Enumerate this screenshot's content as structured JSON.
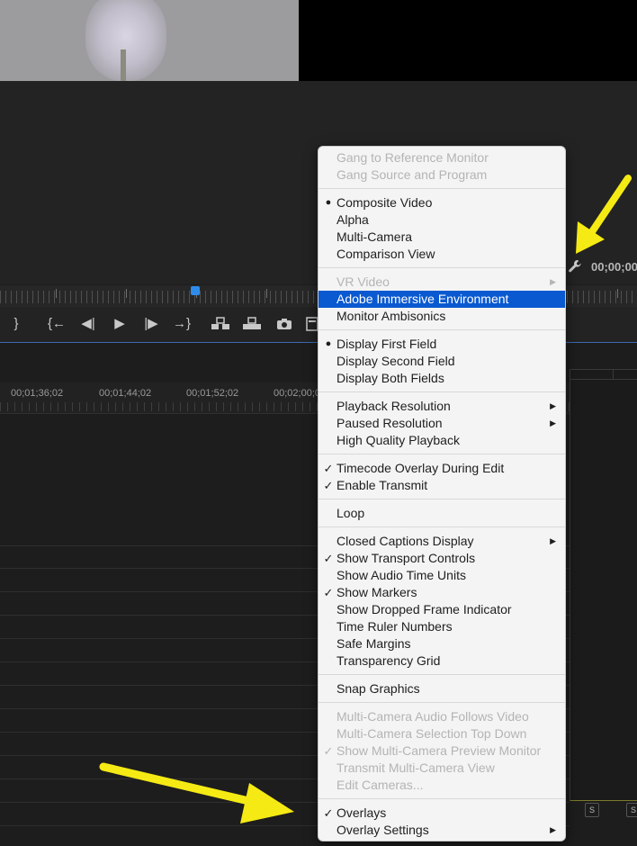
{
  "timeline": {
    "timecode": "00;00;00",
    "ruler_labels": [
      "00;01;36;02",
      "00;01;44;02",
      "00;01;52;02",
      "00;02;00;0"
    ]
  },
  "transport_icons": [
    "mark-out-icon",
    "go-to-in-icon",
    "step-back-icon",
    "play-icon",
    "step-forward-icon",
    "go-to-out-icon",
    "insert-icon",
    "overwrite-icon",
    "export-frame-icon",
    "button-editor-icon"
  ],
  "track_buttons": [
    "S",
    "S"
  ],
  "menu": {
    "sections": [
      {
        "items": [
          {
            "label": "Gang to Reference Monitor",
            "disabled": true
          },
          {
            "label": "Gang Source and Program",
            "disabled": true
          }
        ]
      },
      {
        "items": [
          {
            "label": "Composite Video",
            "mark": "dot"
          },
          {
            "label": "Alpha"
          },
          {
            "label": "Multi-Camera"
          },
          {
            "label": "Comparison View"
          }
        ]
      },
      {
        "items": [
          {
            "label": "VR Video",
            "disabled": true,
            "submenu": true
          },
          {
            "label": "Adobe Immersive Environment",
            "highlighted": true
          },
          {
            "label": "Monitor Ambisonics"
          }
        ]
      },
      {
        "items": [
          {
            "label": "Display First Field",
            "mark": "dot"
          },
          {
            "label": "Display Second Field"
          },
          {
            "label": "Display Both Fields"
          }
        ]
      },
      {
        "items": [
          {
            "label": "Playback Resolution",
            "submenu": true
          },
          {
            "label": "Paused Resolution",
            "submenu": true
          },
          {
            "label": "High Quality Playback"
          }
        ]
      },
      {
        "items": [
          {
            "label": "Timecode Overlay During Edit",
            "mark": "check"
          },
          {
            "label": "Enable Transmit",
            "mark": "check"
          }
        ]
      },
      {
        "items": [
          {
            "label": "Loop"
          }
        ]
      },
      {
        "items": [
          {
            "label": "Closed Captions Display",
            "submenu": true
          },
          {
            "label": "Show Transport Controls",
            "mark": "check"
          },
          {
            "label": "Show Audio Time Units"
          },
          {
            "label": "Show Markers",
            "mark": "check"
          },
          {
            "label": "Show Dropped Frame Indicator"
          },
          {
            "label": "Time Ruler Numbers"
          },
          {
            "label": "Safe Margins"
          },
          {
            "label": "Transparency Grid"
          }
        ]
      },
      {
        "items": [
          {
            "label": "Snap Graphics"
          }
        ]
      },
      {
        "items": [
          {
            "label": "Multi-Camera Audio Follows Video",
            "disabled": true
          },
          {
            "label": "Multi-Camera Selection Top Down",
            "disabled": true
          },
          {
            "label": "Show Multi-Camera Preview Monitor",
            "disabled": true,
            "mark": "check"
          },
          {
            "label": "Transmit Multi-Camera View",
            "disabled": true
          },
          {
            "label": "Edit Cameras...",
            "disabled": true
          }
        ]
      },
      {
        "items": [
          {
            "label": "Overlays",
            "mark": "check"
          },
          {
            "label": "Overlay Settings",
            "submenu": true
          }
        ]
      }
    ]
  },
  "colors": {
    "highlight": "#0a59d0",
    "annotation_arrow": "#f5ea14",
    "playhead": "#2d8ceb"
  }
}
